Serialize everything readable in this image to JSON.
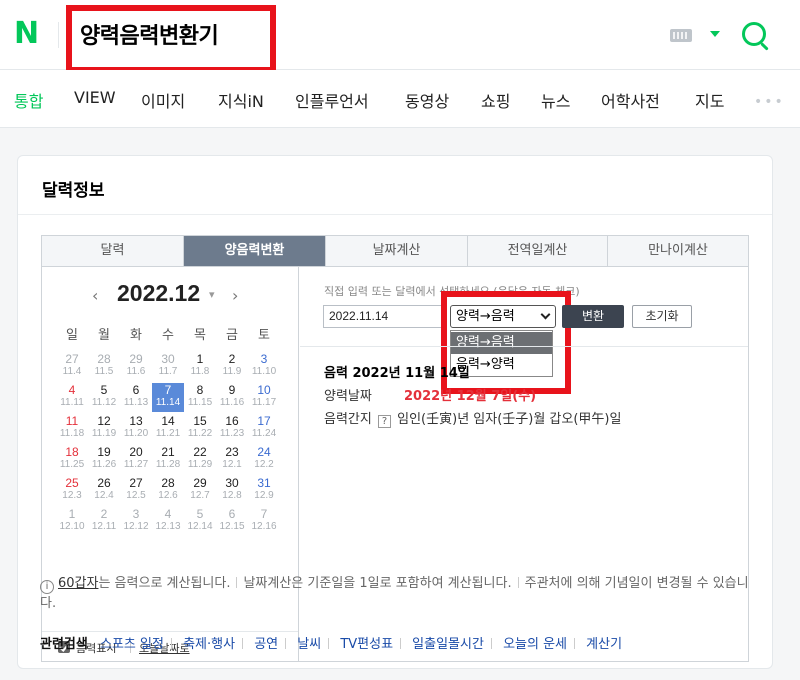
{
  "header": {
    "logo": "N",
    "query": "양력음력변환기"
  },
  "tabs": [
    "통합",
    "VIEW",
    "이미지",
    "지식iN",
    "인플루언서",
    "동영상",
    "쇼핑",
    "뉴스",
    "어학사전",
    "지도"
  ],
  "more": "•••",
  "card": {
    "title": "달력정보",
    "cal_tabs": [
      "달력",
      "양음력변환",
      "날짜계산",
      "전역일계산",
      "만나이계산"
    ],
    "calendar": {
      "month": "2022.12",
      "prev": "‹",
      "next": "›",
      "weekdays": [
        "일",
        "월",
        "화",
        "수",
        "목",
        "금",
        "토"
      ],
      "weeks": [
        [
          [
            "27",
            "11.4"
          ],
          [
            "28",
            "11.5"
          ],
          [
            "29",
            "11.6"
          ],
          [
            "30",
            "11.7"
          ],
          [
            "1",
            "11.8"
          ],
          [
            "2",
            "11.9"
          ],
          [
            "3",
            "11.10"
          ]
        ],
        [
          [
            "4",
            "11.11"
          ],
          [
            "5",
            "11.12"
          ],
          [
            "6",
            "11.13"
          ],
          [
            "7",
            "11.14"
          ],
          [
            "8",
            "11.15"
          ],
          [
            "9",
            "11.16"
          ],
          [
            "10",
            "11.17"
          ]
        ],
        [
          [
            "11",
            "11.18"
          ],
          [
            "12",
            "11.19"
          ],
          [
            "13",
            "11.20"
          ],
          [
            "14",
            "11.21"
          ],
          [
            "15",
            "11.22"
          ],
          [
            "16",
            "11.23"
          ],
          [
            "17",
            "11.24"
          ]
        ],
        [
          [
            "18",
            "11.25"
          ],
          [
            "19",
            "11.26"
          ],
          [
            "20",
            "11.27"
          ],
          [
            "21",
            "11.28"
          ],
          [
            "22",
            "11.29"
          ],
          [
            "23",
            "12.1"
          ],
          [
            "24",
            "12.2"
          ]
        ],
        [
          [
            "25",
            "12.3"
          ],
          [
            "26",
            "12.4"
          ],
          [
            "27",
            "12.5"
          ],
          [
            "28",
            "12.6"
          ],
          [
            "29",
            "12.7"
          ],
          [
            "30",
            "12.8"
          ],
          [
            "31",
            "12.9"
          ]
        ],
        [
          [
            "1",
            "12.10"
          ],
          [
            "2",
            "12.11"
          ],
          [
            "3",
            "12.12"
          ],
          [
            "4",
            "12.13"
          ],
          [
            "5",
            "12.14"
          ],
          [
            "6",
            "12.15"
          ],
          [
            "7",
            "12.16"
          ]
        ]
      ],
      "show_lunar_label": "음력표시",
      "today_link": "오늘날짜로"
    },
    "converter": {
      "hint": "직접 입력 또는 달력에서 선택하세요 (윤달은 자동 체크)",
      "date_value": "2022.11.14",
      "selected_mode": "양력→음력",
      "options": [
        "양력→음력",
        "음력→양력"
      ],
      "convert_button": "변환",
      "reset_button": "초기화",
      "result_title": "음력 2022년 11월 14일",
      "solar_label": "양력날짜",
      "solar_value": "2022년 12월 7일(수)",
      "ganji_label": "음력간지",
      "ganji_q": "?",
      "ganji_value": "임인(壬寅)년 임자(壬子)월 갑오(甲午)일"
    },
    "info": {
      "icon": "i",
      "link": "60갑자",
      "text1": "는 음력으로 계산됩니다.",
      "text2": "날짜계산은 기준일을 1일로 포함하여 계산됩니다.",
      "text3": "주관처에 의해 기념일이 변경될 수 있습니다."
    },
    "related": {
      "label": "관련검색",
      "items": [
        "스포츠 일정",
        "축제·행사",
        "공연",
        "날씨",
        "TV편성표",
        "일출일몰시간",
        "오늘의 운세",
        "계산기"
      ]
    }
  },
  "colors": {
    "brand_green": "#03c75a",
    "highlight_red": "#e8131b",
    "selected_day": "#5a8ad9"
  }
}
